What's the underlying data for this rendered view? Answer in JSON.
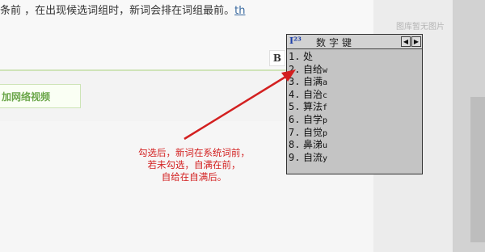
{
  "document": {
    "top_text": "条前  ，在出现候选词组时，新词会排在词组最前。",
    "top_text_link": "th",
    "add_video_label": "加网络视频",
    "bold_button_label": "B",
    "no_image_text": "图库暂无图片"
  },
  "ime": {
    "logo": "I²³",
    "title": "数字键",
    "prev_icon": "prev-page-icon",
    "next_icon": "next-page-icon",
    "candidates": [
      {
        "index": "1.",
        "word": "处",
        "code": ""
      },
      {
        "index": "2.",
        "word": "自给",
        "code": "w"
      },
      {
        "index": "3.",
        "word": "自满",
        "code": "a"
      },
      {
        "index": "4.",
        "word": "自治",
        "code": "c"
      },
      {
        "index": "5.",
        "word": "算法",
        "code": "f"
      },
      {
        "index": "6.",
        "word": "自学",
        "code": "p"
      },
      {
        "index": "7.",
        "word": "自觉",
        "code": "p"
      },
      {
        "index": "8.",
        "word": "鼻涕",
        "code": "u"
      },
      {
        "index": "9.",
        "word": "自流",
        "code": "y"
      }
    ]
  },
  "annotation": {
    "lines": [
      "勾选后，新词在系统词前，",
      "若未勾选，自满在前，",
      "自给在自满后。"
    ],
    "color": "#d32020"
  }
}
